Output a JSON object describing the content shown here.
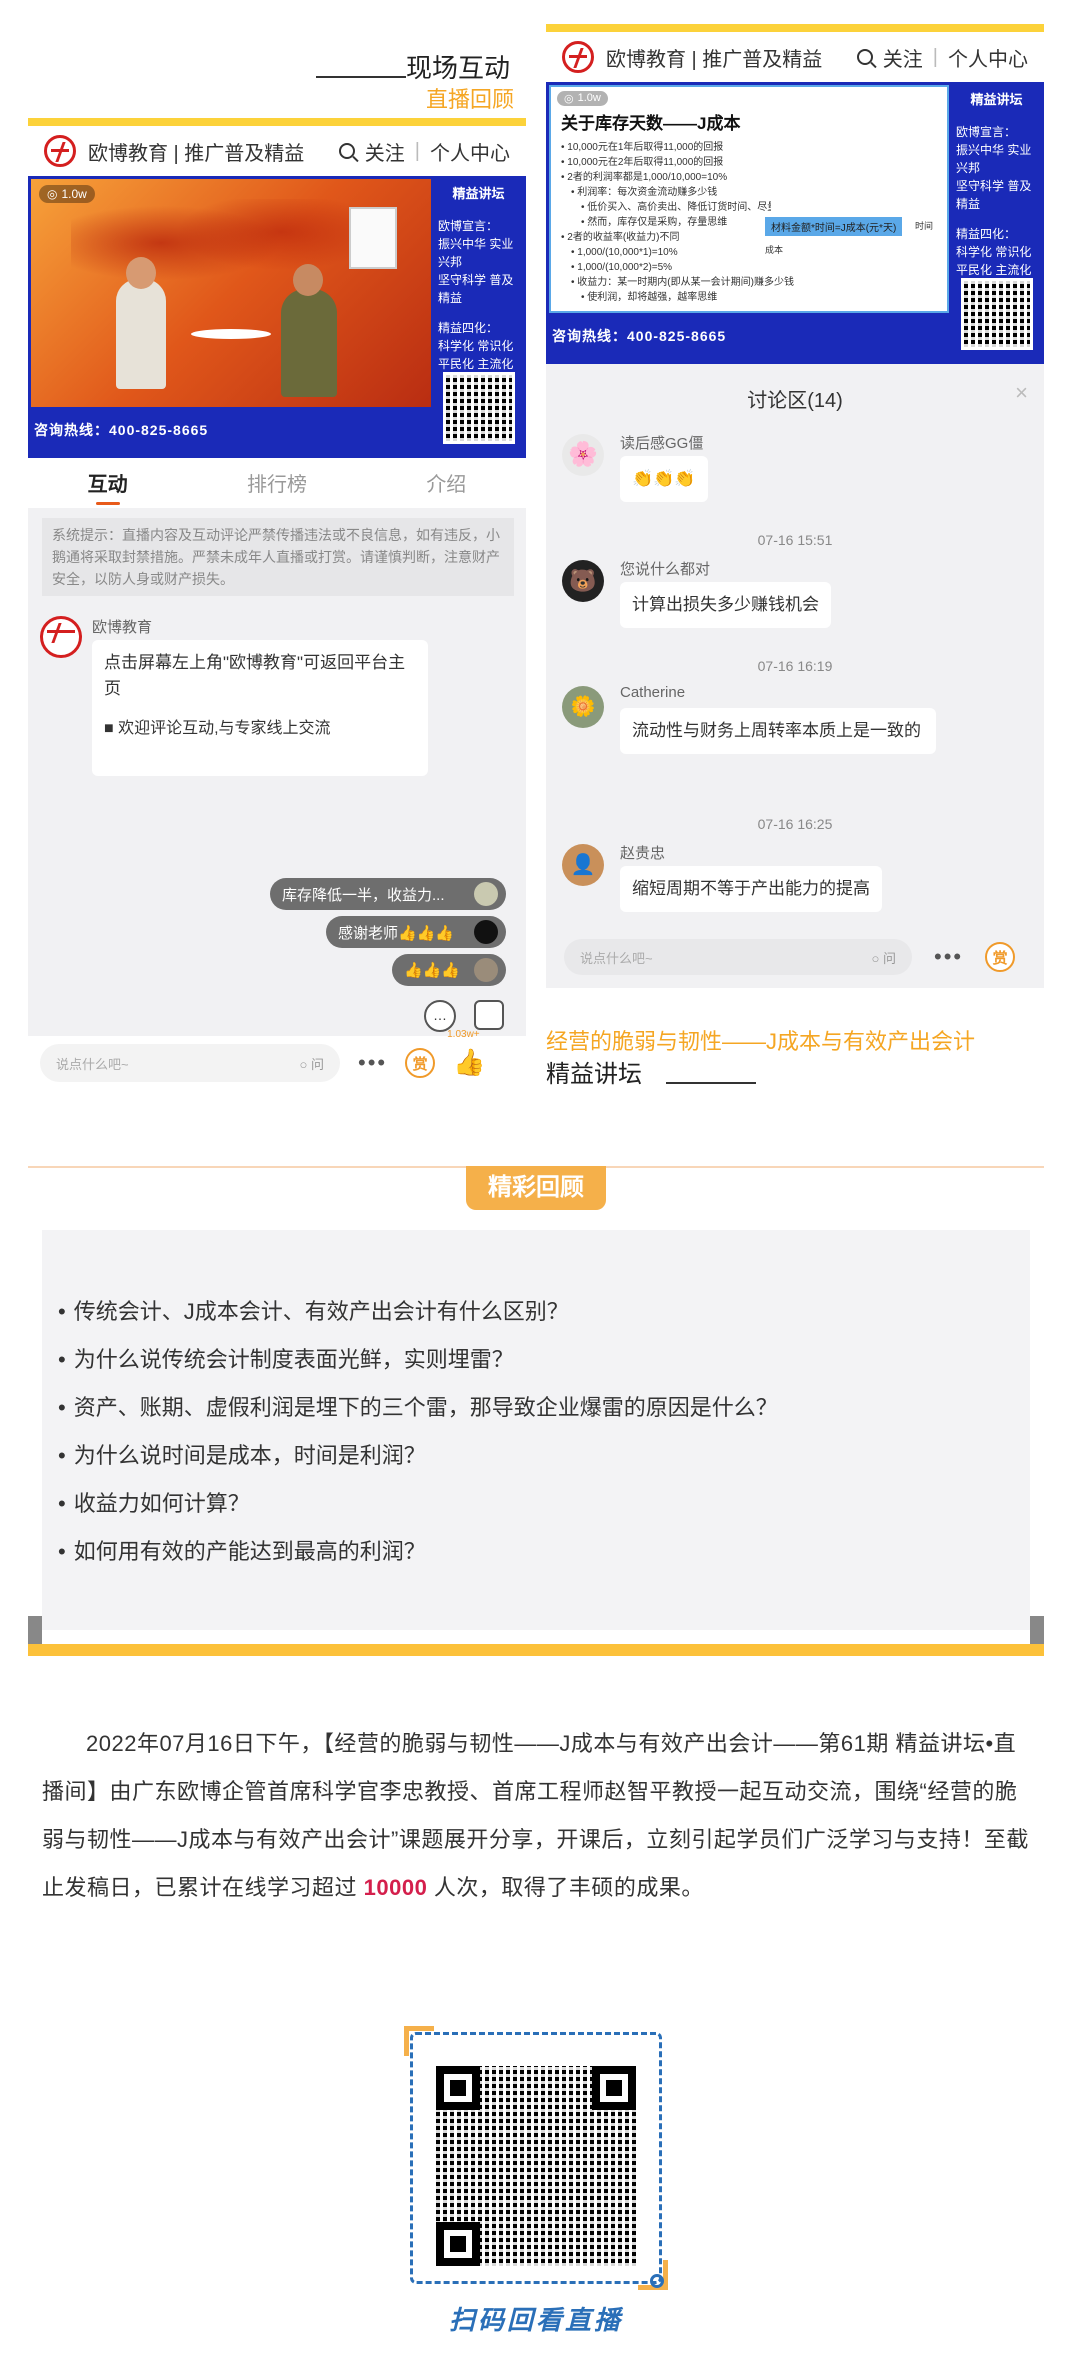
{
  "left_block": {
    "title": "现场互动",
    "subtitle": "直播回顾"
  },
  "left_phone": {
    "brand": "欧博教育 | 推广普及精益",
    "follow": "关注",
    "center": "个人中心",
    "views": "1.0w",
    "side_title": "精益讲坛",
    "side_line1": "欧博宣言：",
    "side_line2": "振兴中华 实业兴邦",
    "side_line3": "坚守科学 普及精益",
    "side_line4": "精益四化：",
    "side_line5": "科学化 常识化",
    "side_line6": "平民化 主流化",
    "hotline": "咨询热线：400-825-8665",
    "tabs": [
      "互动",
      "排行榜",
      "介绍"
    ],
    "notice": "系统提示：直播内容及互动评论严禁传播违法或不良信息，如有违反，小鹅通将采取封禁措施。严禁未成年人直播或打赏。请谨慎判断，注意财产安全，以防人身或财产损失。",
    "host_name": "欧博教育",
    "host_msg1": "点击屏幕左上角\"欧博教育\"可返回平台主页",
    "host_msg2": "■ 欢迎评论互动,与专家线上交流",
    "pill1": "库存降低一半，收益力...",
    "pill2": "感谢老师👍👍👍",
    "pill3": "👍👍👍",
    "input_placeholder": "说点什么吧~",
    "ask": "问",
    "reward": "赏",
    "likes": "1.03w+"
  },
  "right_phone": {
    "brand": "欧博教育 | 推广普及精益",
    "follow": "关注",
    "center": "个人中心",
    "views": "1.0w",
    "slide_title": "关于库存天数——J成本",
    "slide_lines": [
      "• 10,000元在1年后取得11,000的回报",
      "• 10,000元在2年后取得11,000的回报",
      "• 2者的利润率都是1,000/10,000=10%",
      "  • 利润率：每次资金流动赚多少钱",
      "    • 低价买入、高价卖出、降低订货时间、尽量跟踪在库\"利润率\"进行思考。",
      "    • 然而，库存仅是采购，存量思维",
      "• 2者的收益率(收益力)不同",
      "  • 1,000/(10,000*1)=10%",
      "  • 1,000/(10,000*2)=5%",
      "  • 收益力：某一时期内(即从某一会计期间)赚多少钱",
      "    • 使利润，却将越强，越率思维"
    ],
    "slide_box": "材料金额*时间=J成本(元*天)",
    "slide_time": "时间",
    "slide_cost": "成本",
    "side_title": "精益讲坛",
    "side_line1": "欧博宣言：",
    "side_line2": "振兴中华 实业兴邦",
    "side_line3": "坚守科学 普及精益",
    "side_line4": "精益四化：",
    "side_line5": "科学化 常识化",
    "side_line6": "平民化 主流化",
    "hotline": "咨询热线：400-825-8665",
    "discussion_title": "讨论区(14)",
    "messages": [
      {
        "name": "读后感GG僵",
        "text": "👏👏👏",
        "time": ""
      },
      {
        "name": "您说什么都对",
        "text": "计算出损失多少赚钱机会",
        "time": "07-16 15:51"
      },
      {
        "name": "Catherine",
        "text": "流动性与财务上周转率本质上是一致的",
        "time": "07-16 16:19"
      },
      {
        "name": "赵贵忠",
        "text": "缩短周期不等于产出能力的提高",
        "time": "07-16 16:25"
      }
    ],
    "input_placeholder": "说点什么吧~",
    "ask": "问",
    "reward": "赏"
  },
  "right_block": {
    "title": "经营的脆弱与韧性——J成本与有效产出会计",
    "subtitle": "精益讲坛"
  },
  "review": {
    "badge": "精彩回顾",
    "questions": [
      "传统会计、J成本会计、有效产出会计有什么区别？",
      "为什么说传统会计制度表面光鲜，实则埋雷？",
      "资产、账期、虚假利润是埋下的三个雷，那导致企业爆雷的原因是什么？",
      "为什么说时间是成本，时间是利润？",
      "收益力如何计算？",
      "如何用有效的产能达到最高的利润？"
    ]
  },
  "article": {
    "para_a": "2022年07月16日下午，【经营的脆弱与韧性——J成本与有效产出会计——第61期 精益讲坛•直播间】由广东欧博企管首席科学官李忠教授、首席工程师赵智平教授一起互动交流，围绕“经营的脆弱与韧性——J成本与有效产出会计”课题展开分享，开课后，立刻引起学员们广泛学习与支持！至截止发稿日，已累计在线学习超过",
    "highlight": " 10000 ",
    "para_b": "人次，取得了丰硕的成果。"
  },
  "qr_caption": "扫码回看直播",
  "colors": {
    "accent": "#f5a623",
    "yellow": "#fcd23a",
    "brand_red": "#d41f1f",
    "blue": "#1a2ab8"
  }
}
